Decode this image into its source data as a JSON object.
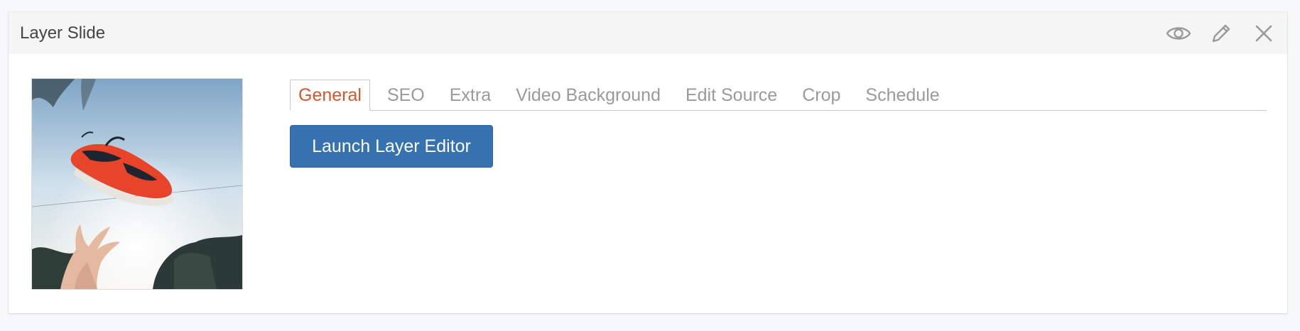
{
  "panel": {
    "title": "Layer Slide",
    "actions": [
      {
        "icon": "eye-icon",
        "name": "preview-button"
      },
      {
        "icon": "pencil-icon",
        "name": "edit-button"
      },
      {
        "icon": "close-icon",
        "name": "close-button"
      }
    ]
  },
  "thumbnail": {
    "description_icon": "slide-thumbnail-image"
  },
  "tabs": [
    {
      "label": "General",
      "active": true
    },
    {
      "label": "SEO",
      "active": false
    },
    {
      "label": "Extra",
      "active": false
    },
    {
      "label": "Video Background",
      "active": false
    },
    {
      "label": "Edit Source",
      "active": false
    },
    {
      "label": "Crop",
      "active": false
    },
    {
      "label": "Schedule",
      "active": false
    }
  ],
  "general": {
    "launch_label": "Launch Layer Editor"
  },
  "colors": {
    "accent_tab": "#d4582b",
    "primary_button": "#3671b0",
    "header_bg": "#f5f5f5",
    "icon_gray": "#9a9a9a"
  }
}
